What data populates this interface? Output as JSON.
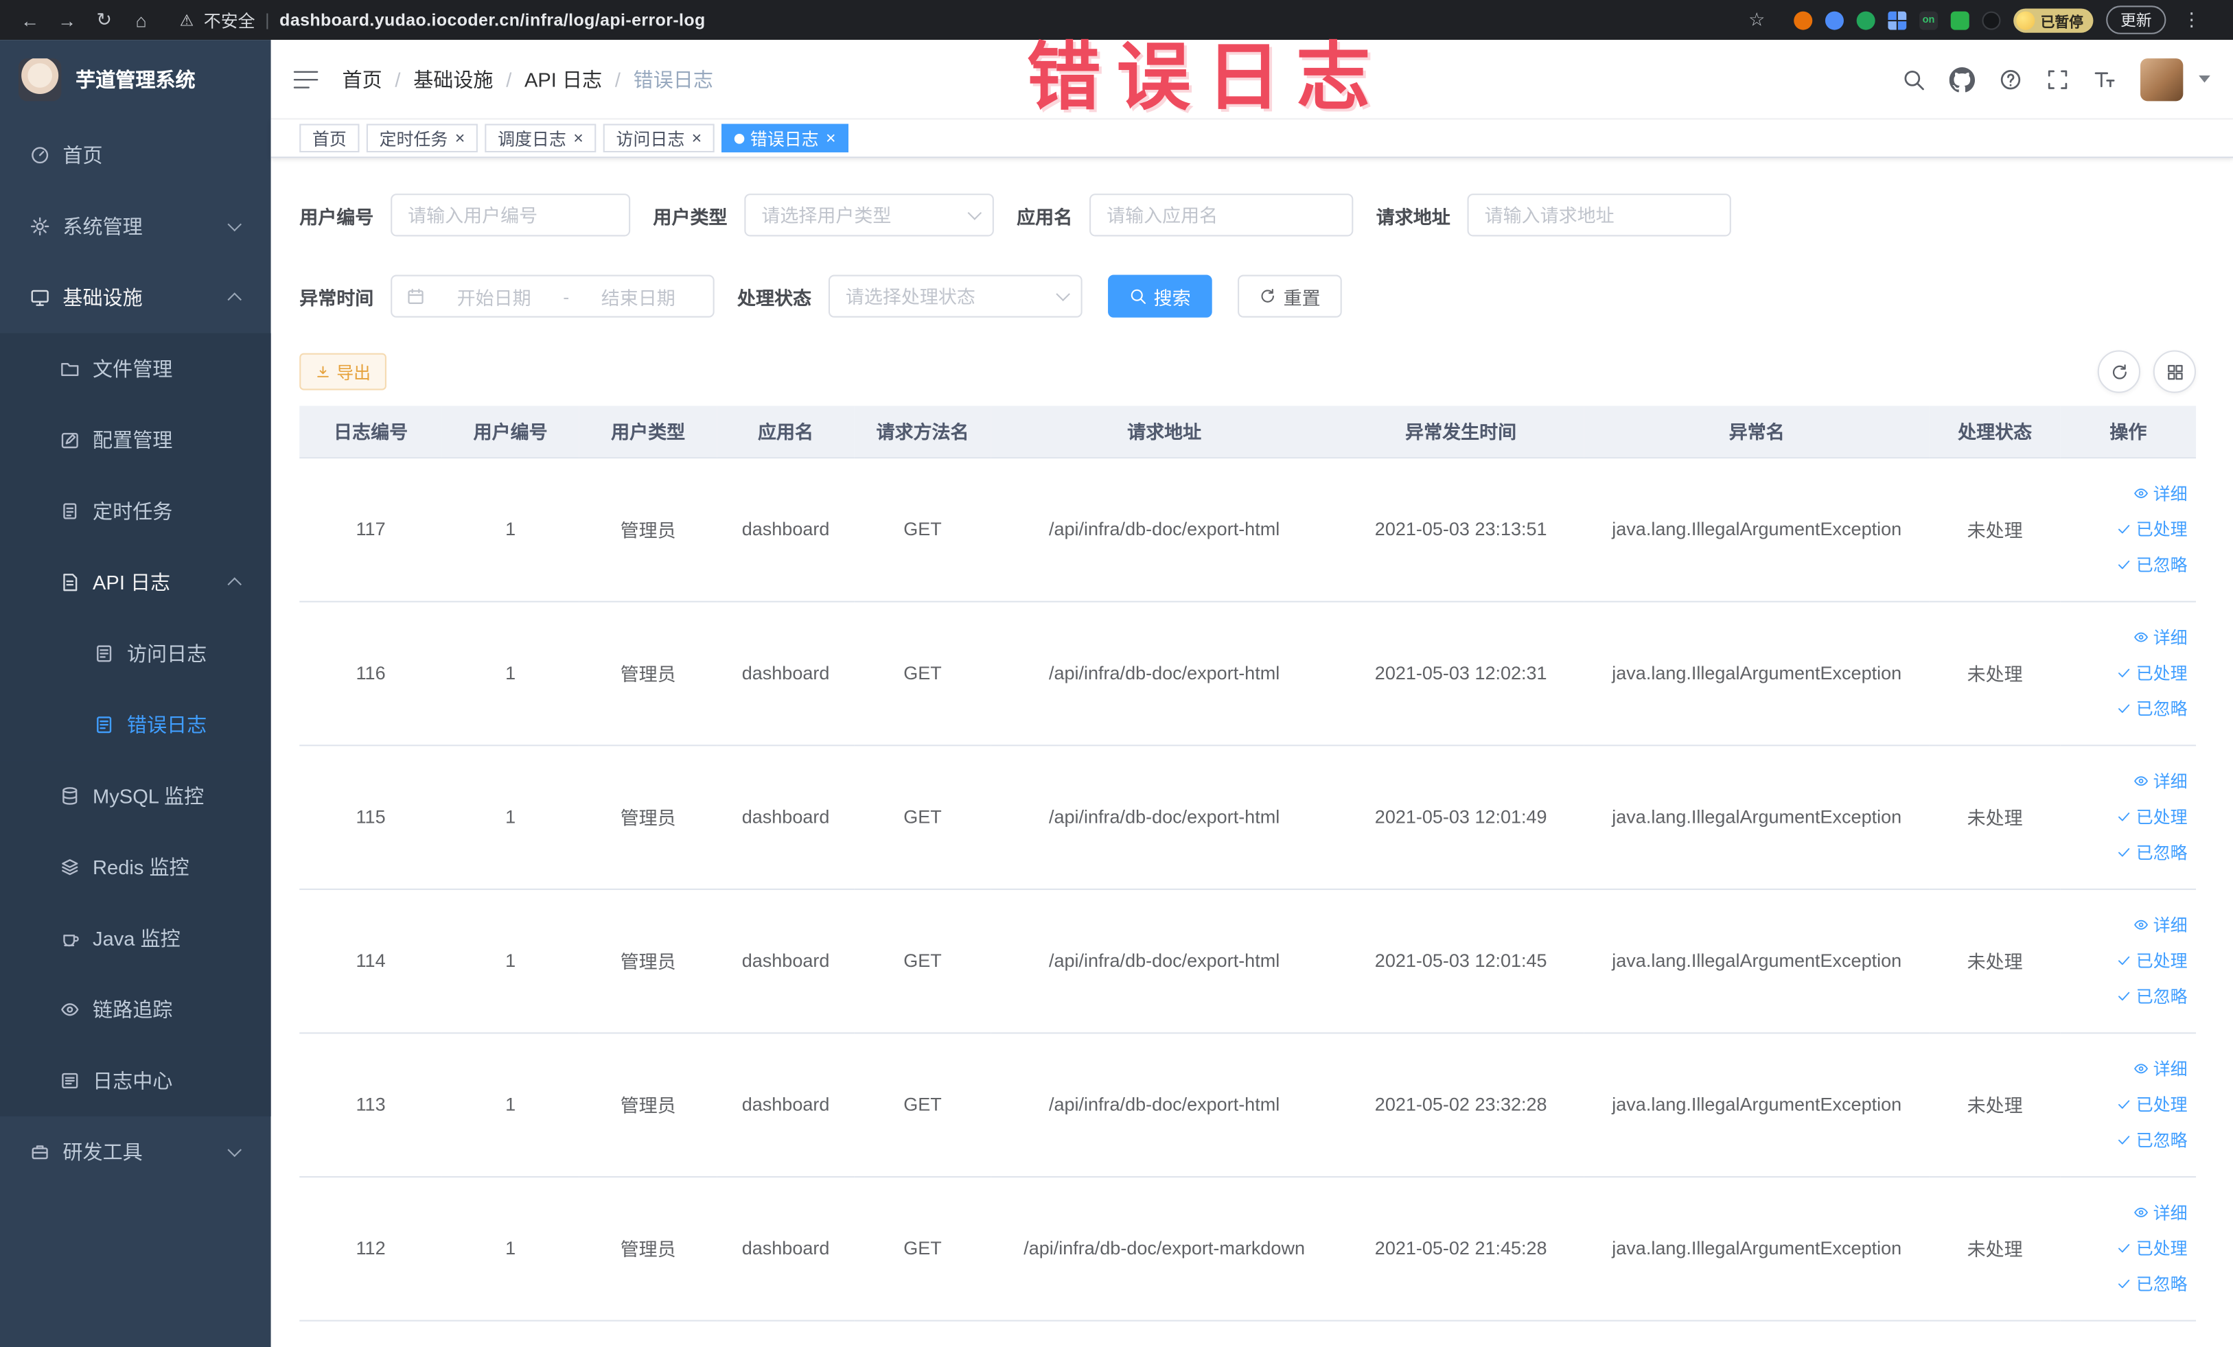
{
  "colors": {
    "accent": "#409eff",
    "warning": "#e6a23c",
    "annotation_red": "#ee4b5e",
    "sidebar_bg": "#304156"
  },
  "browser": {
    "back_icon": "←",
    "forward_icon": "→",
    "reload_icon": "↻",
    "home_icon": "⌂",
    "warning_icon": "⚠",
    "security_text": "不安全",
    "divider": "|",
    "url": "dashboard.yudao.iocoder.cn/infra/log/api-error-log",
    "bookmark_icon": "☆",
    "extension_on_text": "on",
    "paused_badge": "已暂停",
    "update_button": "更新",
    "menu_icon": "⋮"
  },
  "sidebar": {
    "logo_text": "芋道管理系统",
    "items": [
      {
        "label": "首页",
        "level": 0,
        "icon": "dashboard"
      },
      {
        "label": "系统管理",
        "level": 0,
        "icon": "gear",
        "chevron": "down"
      },
      {
        "label": "基础设施",
        "level": 0,
        "icon": "infra",
        "chevron": "up",
        "open": true
      },
      {
        "label": "文件管理",
        "level": 1,
        "icon": "file",
        "nested": true
      },
      {
        "label": "配置管理",
        "level": 1,
        "icon": "edit",
        "nested": true
      },
      {
        "label": "定时任务",
        "level": 1,
        "icon": "task",
        "nested": true
      },
      {
        "label": "API 日志",
        "level": 1,
        "icon": "log",
        "chevron": "up",
        "open": true,
        "nested": true
      },
      {
        "label": "访问日志",
        "level": 2,
        "icon": "doc",
        "nested": true
      },
      {
        "label": "错误日志",
        "level": 2,
        "icon": "doc",
        "active": true,
        "nested": true
      },
      {
        "label": "MySQL 监控",
        "level": 1,
        "icon": "db",
        "nested": true
      },
      {
        "label": "Redis 监控",
        "level": 1,
        "icon": "redis",
        "nested": true
      },
      {
        "label": "Java 监控",
        "level": 1,
        "icon": "java",
        "nested": true
      },
      {
        "label": "链路追踪",
        "level": 1,
        "icon": "trace",
        "nested": true
      },
      {
        "label": "日志中心",
        "level": 1,
        "icon": "logcenter",
        "nested": true
      },
      {
        "label": "研发工具",
        "level": 0,
        "icon": "tool",
        "chevron": "down"
      }
    ]
  },
  "header": {
    "breadcrumb": [
      "首页",
      "基础设施",
      "API 日志",
      "错误日志"
    ],
    "breadcrumb_separator": "/"
  },
  "tabs": [
    {
      "label": "首页",
      "closable": false,
      "active": false
    },
    {
      "label": "定时任务",
      "closable": true,
      "active": false
    },
    {
      "label": "调度日志",
      "closable": true,
      "active": false
    },
    {
      "label": "访问日志",
      "closable": true,
      "active": false
    },
    {
      "label": "错误日志",
      "closable": true,
      "active": true
    }
  ],
  "annotation": "错误日志",
  "filters": {
    "user_id": {
      "label": "用户编号",
      "placeholder": "请输入用户编号"
    },
    "user_type": {
      "label": "用户类型",
      "placeholder": "请选择用户类型"
    },
    "app_name": {
      "label": "应用名",
      "placeholder": "请输入应用名"
    },
    "request_url": {
      "label": "请求地址",
      "placeholder": "请输入请求地址"
    },
    "exception_time": {
      "label": "异常时间",
      "start_placeholder": "开始日期",
      "separator": "-",
      "end_placeholder": "结束日期"
    },
    "process_status": {
      "label": "处理状态",
      "placeholder": "请选择处理状态"
    },
    "search_label": "搜索",
    "reset_label": "重置"
  },
  "toolbar": {
    "export_label": "导出"
  },
  "table": {
    "columns": [
      "日志编号",
      "用户编号",
      "用户类型",
      "应用名",
      "请求方法名",
      "请求地址",
      "异常发生时间",
      "异常名",
      "处理状态",
      "操作"
    ],
    "rows": [
      [
        "117",
        "1",
        "管理员",
        "dashboard",
        "GET",
        "/api/infra/db-doc/export-html",
        "2021-05-03 23:13:51",
        "java.lang.IllegalArgumentException",
        "未处理"
      ],
      [
        "116",
        "1",
        "管理员",
        "dashboard",
        "GET",
        "/api/infra/db-doc/export-html",
        "2021-05-03 12:02:31",
        "java.lang.IllegalArgumentException",
        "未处理"
      ],
      [
        "115",
        "1",
        "管理员",
        "dashboard",
        "GET",
        "/api/infra/db-doc/export-html",
        "2021-05-03 12:01:49",
        "java.lang.IllegalArgumentException",
        "未处理"
      ],
      [
        "114",
        "1",
        "管理员",
        "dashboard",
        "GET",
        "/api/infra/db-doc/export-html",
        "2021-05-03 12:01:45",
        "java.lang.IllegalArgumentException",
        "未处理"
      ],
      [
        "113",
        "1",
        "管理员",
        "dashboard",
        "GET",
        "/api/infra/db-doc/export-html",
        "2021-05-02 23:32:28",
        "java.lang.IllegalArgumentException",
        "未处理"
      ],
      [
        "112",
        "1",
        "管理员",
        "dashboard",
        "GET",
        "/api/infra/db-doc/export-markdown",
        "2021-05-02 21:45:28",
        "java.lang.IllegalArgumentException",
        "未处理"
      ]
    ],
    "row_actions": [
      "详细",
      "已处理",
      "已忽略"
    ]
  }
}
